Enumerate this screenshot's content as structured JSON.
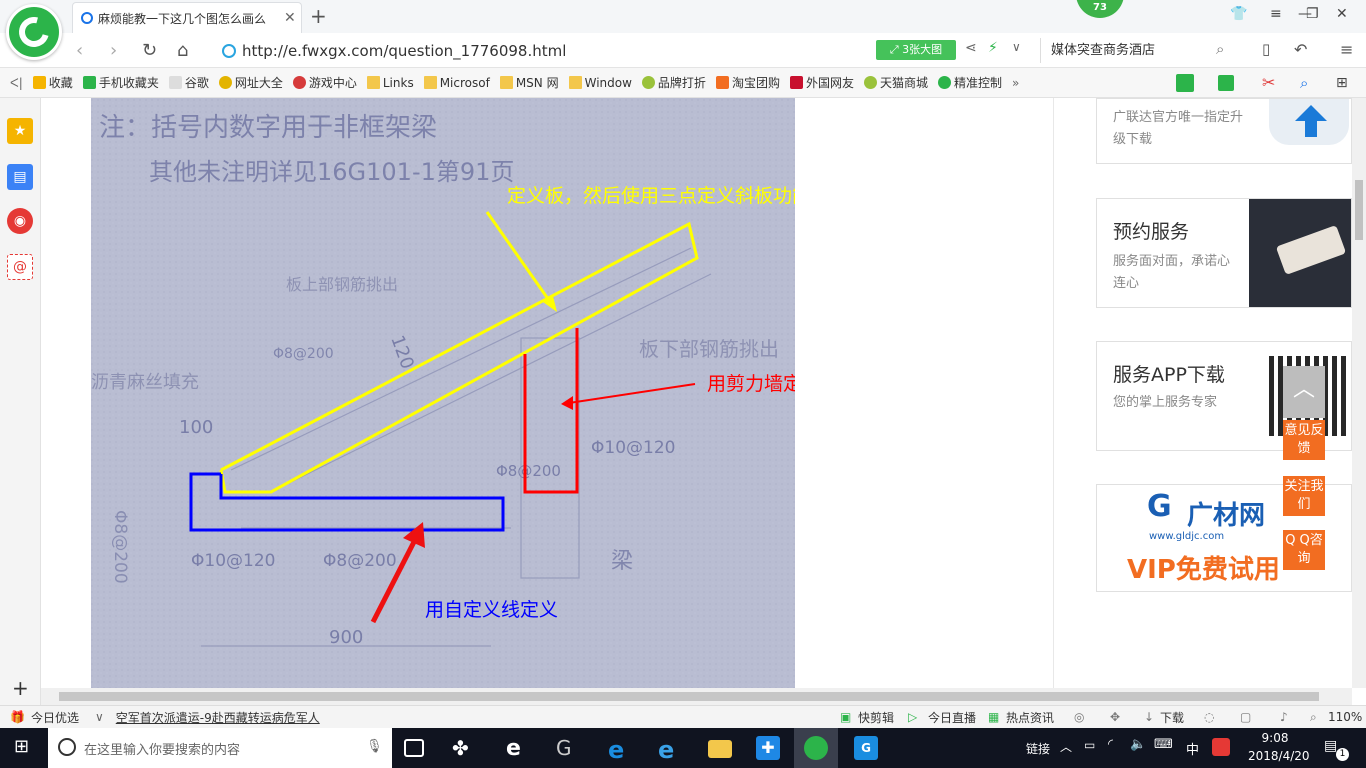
{
  "browser": {
    "badge": "73",
    "tab_title": "麻烦能教一下这几个图怎么画么",
    "url": "http://e.fwxgx.com/question_1776098.html",
    "bigpic_label": "3张大图",
    "search_text": "媒体突查商务酒店"
  },
  "bookmarks": [
    {
      "label": "收藏",
      "icon": "star-icon"
    },
    {
      "label": "手机收藏夹",
      "icon": "phone-icon"
    },
    {
      "label": "谷歌",
      "icon": "page-icon"
    },
    {
      "label": "网址大全",
      "icon": "globe-icon"
    },
    {
      "label": "游戏中心",
      "icon": "game-icon"
    },
    {
      "label": "Links",
      "icon": "folder-icon"
    },
    {
      "label": "Microsof",
      "icon": "folder-icon"
    },
    {
      "label": "MSN 网",
      "icon": "folder-icon"
    },
    {
      "label": "Window",
      "icon": "folder-icon"
    },
    {
      "label": "品牌打折",
      "icon": "leaf-icon"
    },
    {
      "label": "淘宝团购",
      "icon": "taobao-icon"
    },
    {
      "label": "外国网友",
      "icon": "flag-icon"
    },
    {
      "label": "天猫商城",
      "icon": "leaf-icon"
    },
    {
      "label": "精准控制",
      "icon": "chat-icon"
    }
  ],
  "photo": {
    "handwritten_1": "注：括号内数字用于非框架梁",
    "handwritten_2": "其他未注明详见16G101-1第91页",
    "label_top": "板上部钢筋挑出",
    "label_right": "板下部钢筋挑出",
    "label_left": "沥青麻丝填充",
    "dim_100": "100",
    "dim_120": "120",
    "dim_900": "900",
    "rebar_a": "Φ8@200",
    "rebar_b": "Φ10@120",
    "rebar_c": "Φ8@200",
    "rebar_d": "Φ10@120",
    "rebar_e": "Φ8@200",
    "rebar_f": "Φ8@200",
    "beam": "梁",
    "annotation_yellow": "定义板，然后使用三点定义斜板功能",
    "annotation_red": "用剪力墙定义",
    "annotation_blue": "用自定义线定义"
  },
  "right_cards": {
    "upgrade_sub": "广联达官方唯一指定升级下载",
    "booking_title": "预约服务",
    "booking_sub": "服务面对面，承诺心连心",
    "app_title": "服务APP下载",
    "app_sub": "您的掌上服务专家",
    "ad_brand": "广材网",
    "ad_url": "www.gldjc.com",
    "ad_vip": "VIP免费试用"
  },
  "float_buttons": [
    "意见反馈",
    "关注我们",
    "Q Q咨询"
  ],
  "statusbar": {
    "today": "今日优选",
    "news": "空军首次派遣运-9赴西藏转运病危军人",
    "items": [
      "快剪辑",
      "今日直播",
      "热点资讯",
      "下载"
    ],
    "zoom": "110%"
  },
  "taskbar": {
    "search_placeholder": "在这里输入你要搜索的内容",
    "link": "链接",
    "ime": "中",
    "time": "9:08",
    "date": "2018/4/20",
    "notif": "1"
  },
  "colors": {
    "accent_green": "#45c25a",
    "orange": "#f26d21",
    "yellow": "#ffff00",
    "red": "#ff0000",
    "blue": "#0000ff"
  }
}
